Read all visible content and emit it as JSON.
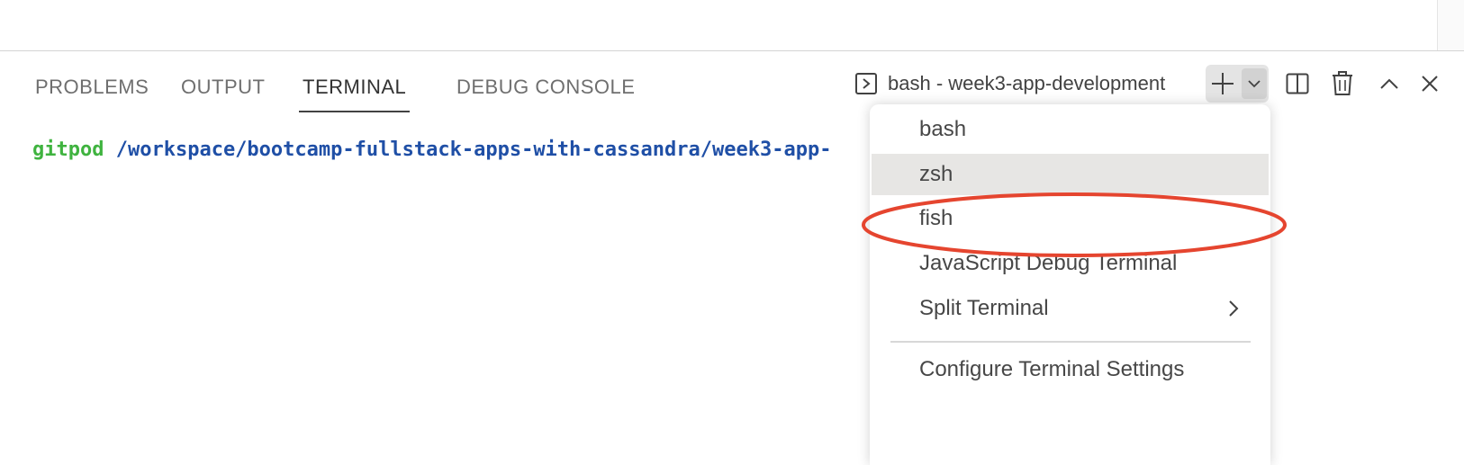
{
  "panel": {
    "tabs": [
      {
        "label": "PROBLEMS"
      },
      {
        "label": "OUTPUT"
      },
      {
        "label": "TERMINAL"
      },
      {
        "label": "DEBUG CONSOLE"
      }
    ],
    "active_tab": "TERMINAL",
    "terminal_selector": {
      "label": "bash - week3-app-development",
      "icon": "terminal-icon"
    },
    "actions": [
      {
        "name": "new-terminal",
        "icon": "plus-icon"
      },
      {
        "name": "launch-profile",
        "icon": "chevron-down-icon"
      },
      {
        "name": "split-terminal",
        "icon": "split-icon"
      },
      {
        "name": "kill-terminal",
        "icon": "trash-icon"
      },
      {
        "name": "maximize-panel",
        "icon": "chevron-up-icon"
      },
      {
        "name": "close-panel",
        "icon": "close-icon"
      }
    ]
  },
  "terminal": {
    "prompt_user": "gitpod",
    "prompt_path": "/workspace/bootcamp-fullstack-apps-with-cassandra/week3-app-"
  },
  "profile_menu": {
    "items": [
      {
        "label": "bash"
      },
      {
        "label": "zsh"
      },
      {
        "label": "fish"
      },
      {
        "label": "JavaScript Debug Terminal"
      },
      {
        "label": "Split Terminal"
      }
    ],
    "footer_item": {
      "label": "Configure Terminal Settings"
    },
    "highlighted_item": "zsh"
  },
  "annotation": {
    "shape": "ellipse",
    "color": "#e5452f",
    "target": "zsh"
  },
  "colors": {
    "prompt_user": "#3fb33f",
    "prompt_path": "#1f4fa6",
    "highlight": "#e7e6e4",
    "accent_underline": "#424242"
  }
}
